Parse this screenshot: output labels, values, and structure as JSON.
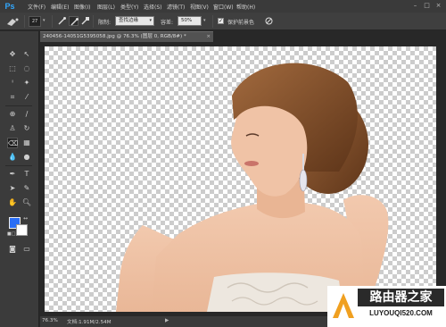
{
  "app": {
    "logo": "Ps"
  },
  "menu": [
    "文件(F)",
    "编辑(E)",
    "图像(I)",
    "图层(L)",
    "类型(Y)",
    "选择(S)",
    "滤镜(T)",
    "视图(V)",
    "窗口(W)",
    "帮助(H)"
  ],
  "window_controls": [
    "–",
    "□",
    "×"
  ],
  "options_bar": {
    "brush_size": "27",
    "limits_label": "限制:",
    "limits_value": "查找边缘",
    "tolerance_label": "容差:",
    "tolerance_value": "50%",
    "protect_label": "保护前景色",
    "protect_checked": true
  },
  "document": {
    "tab_title": "240456-14051G5395058.jpg @ 76.3% (图层 0, RGB/8#) *",
    "tab_close": "×"
  },
  "status": {
    "zoom": "76.3%",
    "doc_info": "文档:1.91M/2.54M",
    "arrow": "▶"
  },
  "colors": {
    "foreground": "#2a6ef5",
    "background": "#ffffff",
    "accent": "#31a8ff"
  },
  "watermark": {
    "title": "路由器之家",
    "url": "LUYOUQI520.COM"
  },
  "tools": [
    "move-tool",
    "marquee-tool",
    "lasso-tool",
    "magic-wand-tool",
    "crop-tool",
    "eyedropper-tool",
    "healing-brush-tool",
    "brush-tool",
    "clone-stamp-tool",
    "history-brush-tool",
    "background-eraser-tool",
    "gradient-tool",
    "blur-tool",
    "dodge-tool",
    "pen-tool",
    "type-tool",
    "path-selection-tool",
    "shape-tool",
    "hand-tool",
    "zoom-tool",
    "quick-mask-tool",
    "screen-mode-tool"
  ]
}
